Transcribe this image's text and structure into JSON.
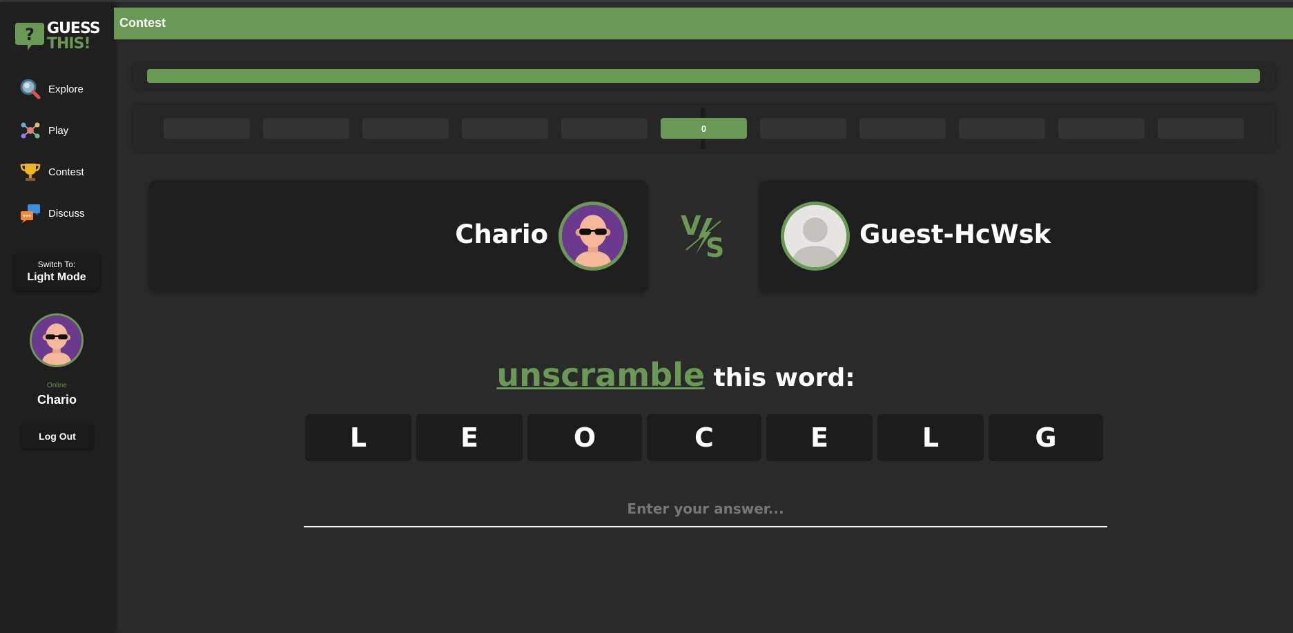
{
  "app": {
    "logo_line1": "GUESS",
    "logo_line2": "THIS!"
  },
  "sidebar": {
    "items": [
      {
        "label": "Explore",
        "icon": "magnifier-icon"
      },
      {
        "label": "Play",
        "icon": "molecule-icon"
      },
      {
        "label": "Contest",
        "icon": "trophy-icon"
      },
      {
        "label": "Discuss",
        "icon": "chat-bubbles-icon"
      }
    ],
    "mode_switch_small": "Switch To:",
    "mode_switch_big": "Light Mode",
    "user_status": "Online",
    "user_name": "Chario",
    "logout_label": "Log Out"
  },
  "header": {
    "title": "Contest"
  },
  "progress": {
    "fraction": 1.0
  },
  "rounds": {
    "active_value": "0",
    "active_index": 5,
    "count": 11
  },
  "match": {
    "player1": "Chario",
    "player2": "Guest-HcWsk",
    "vs_label": "VS"
  },
  "puzzle": {
    "prompt_highlight": "unscramble",
    "prompt_rest": "this word:",
    "letters": [
      "L",
      "E",
      "O",
      "C",
      "E",
      "L",
      "G"
    ]
  },
  "answer": {
    "placeholder": "Enter your answer...",
    "value": ""
  },
  "colors": {
    "accent": "#6a9955",
    "background": "#2a2a2a",
    "sidebar": "#1f1f1f"
  }
}
